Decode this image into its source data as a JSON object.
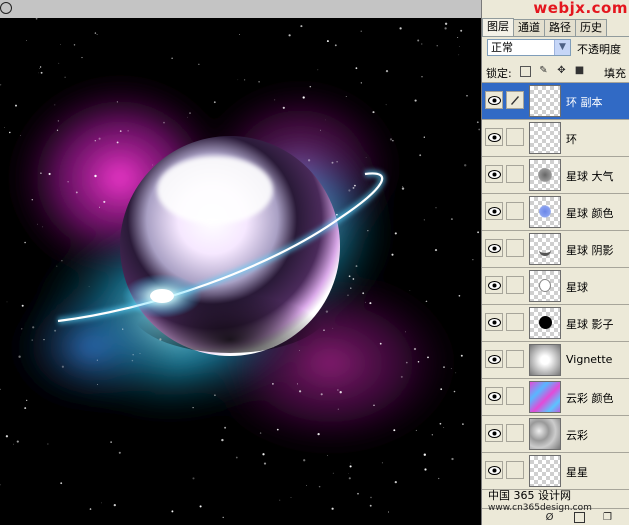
{
  "panel": {
    "watermark_top": "webjx.com",
    "tabs": [
      {
        "label": "图层"
      },
      {
        "label": "通道"
      },
      {
        "label": "路径"
      },
      {
        "label": "历史"
      }
    ],
    "blend_mode": "正常",
    "opacity_label": "不透明度",
    "lock_label": "锁定:",
    "fill_label": "填充",
    "layers": [
      {
        "name": "环 副本"
      },
      {
        "name": "环"
      },
      {
        "name": "星球 大气"
      },
      {
        "name": "星球 颜色"
      },
      {
        "name": "星球 阴影"
      },
      {
        "name": "星球"
      },
      {
        "name": "星球 影子"
      },
      {
        "name": "Vignette"
      },
      {
        "name": "云彩 颜色"
      },
      {
        "name": "云彩"
      },
      {
        "name": "星星"
      }
    ],
    "selected_layer": "环 副本"
  },
  "watermark_bottom": {
    "line1": "中国 365 设计网",
    "line2": "www.cn365design.com"
  },
  "colors": {
    "selected_row": "#316ac5",
    "panel_bg": "#ece9d8",
    "watermark_red": "#e4161e"
  }
}
